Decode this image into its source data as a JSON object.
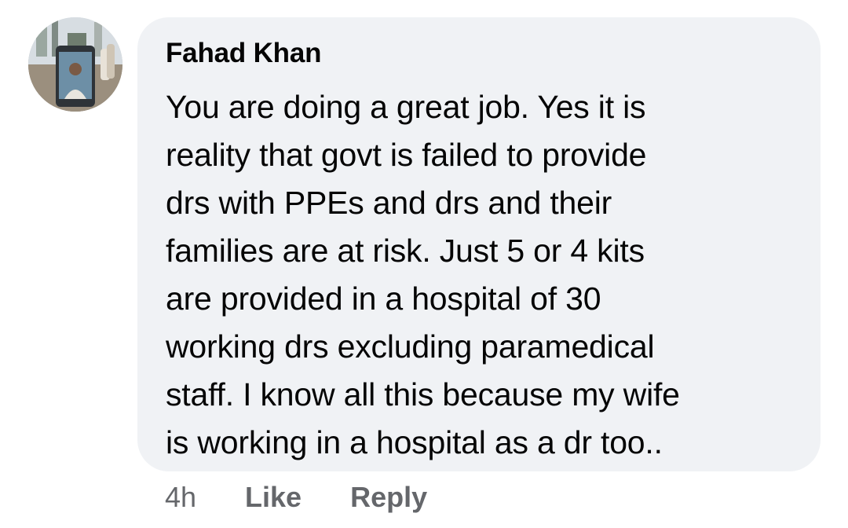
{
  "comment": {
    "author": "Fahad Khan",
    "lines": [
      "You are doing a great job. Yes it is",
      "reality that govt is failed to provide",
      "drs with PPEs and drs and their",
      "families are at risk. Just 5 or 4 kits",
      "are provided in a hospital of 30",
      "working drs excluding paramedical",
      "staff. I know all this because my wife",
      "is working in a hospital as a dr too.."
    ],
    "avatar": "profile-photo"
  },
  "actions": {
    "time": "4h",
    "like_label": "Like",
    "reply_label": "Reply"
  },
  "colors": {
    "bubble": "#f0f2f5",
    "text": "#050505",
    "meta": "#65676b"
  }
}
